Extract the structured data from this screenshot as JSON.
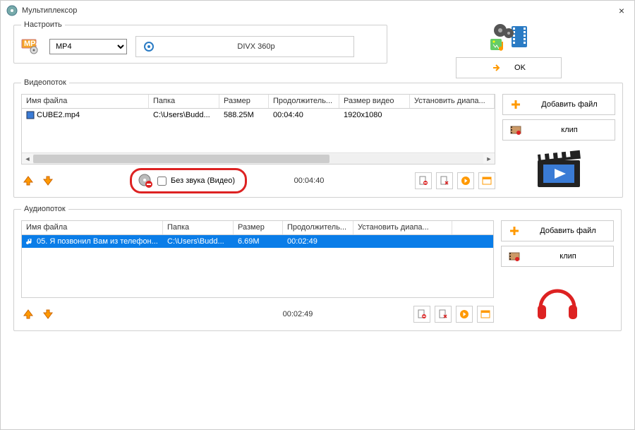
{
  "window": {
    "title": "Мультиплексор"
  },
  "settings": {
    "legend": "Настроить",
    "format": "MP4",
    "preset": "DIVX 360p"
  },
  "ok_label": "OK",
  "video": {
    "legend": "Видеопоток",
    "cols": [
      "Имя файла",
      "Папка",
      "Размер",
      "Продолжитель...",
      "Размер видео",
      "Установить диапа..."
    ],
    "row": {
      "name": "CUBE2.mp4",
      "folder": "C:\\Users\\Budd...",
      "size": "588.25M",
      "dur": "00:04:40",
      "res": "1920x1080",
      "range": ""
    },
    "mute_label": "Без звука (Видео)",
    "total_dur": "00:04:40"
  },
  "audio": {
    "legend": "Аудиопоток",
    "cols": [
      "Имя файла",
      "Папка",
      "Размер",
      "Продолжитель...",
      "Установить диапа..."
    ],
    "row": {
      "name": "05. Я позвонил Вам из телефон...",
      "folder": "C:\\Users\\Budd...",
      "size": "6.69M",
      "dur": "00:02:49",
      "range": ""
    },
    "total_dur": "00:02:49"
  },
  "side": {
    "add_file": "Добавить файл",
    "clip": "клип"
  }
}
